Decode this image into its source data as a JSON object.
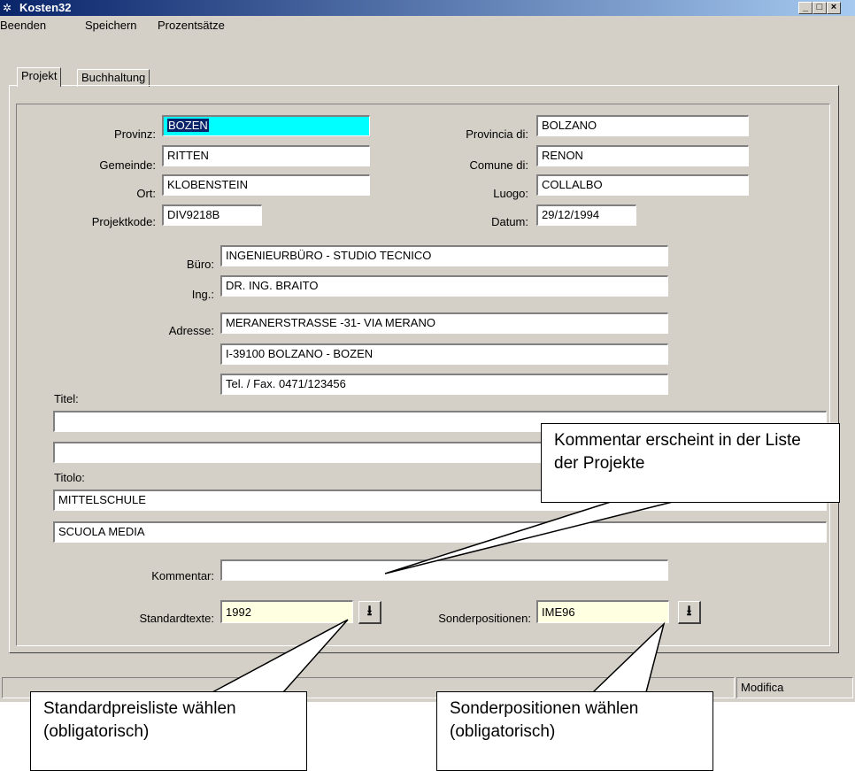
{
  "window": {
    "title": "Kosten32",
    "icon": "app-icon"
  },
  "menu": [
    "Beenden",
    "Speichern",
    "Prozentsätze"
  ],
  "tabs": [
    "Projekt",
    "Buchhaltung"
  ],
  "form": {
    "provinz_label": "Provinz:",
    "provinz_value": "BOZEN",
    "gemeinde_label": "Gemeinde:",
    "gemeinde_value": "RITTEN",
    "ort_label": "Ort:",
    "ort_value": "KLOBENSTEIN",
    "projektkode_label": "Projektkode:",
    "projektkode_value": "DIV9218B",
    "provincia_label": "Provincia di:",
    "provincia_value": "BOLZANO",
    "comune_label": "Comune di:",
    "comune_value": "RENON",
    "luogo_label": "Luogo:",
    "luogo_value": "COLLALBO",
    "datum_label": "Datum:",
    "datum_value": "29/12/1994",
    "buero_label": "Büro:",
    "buero_value": "INGENIEURBÜRO - STUDIO TECNICO",
    "ing_label": "Ing.:",
    "ing_value": "DR. ING. BRAITO",
    "adresse_label": "Adresse:",
    "adresse_1": "MERANERSTRASSE -31- VIA MERANO",
    "adresse_2": "I-39100 BOLZANO - BOZEN",
    "adresse_3": "Tel. / Fax. 0471/123456",
    "titel_label": "Titel:",
    "titel_1": "",
    "titel_2": "",
    "titolo_label": "Titolo:",
    "titolo_1": "MITTELSCHULE",
    "titolo_2": "SCUOLA MEDIA",
    "kommentar_label": "Kommentar:",
    "kommentar_value": "",
    "standardtexte_label": "Standardtexte:",
    "standardtexte_value": "1992",
    "sonderpositionen_label": "Sonderpositionen:",
    "sonderpositionen_value": "IME96",
    "dropdown_glyph": "⭳"
  },
  "status": {
    "mode": "Modifica"
  },
  "callouts": {
    "kommentar": "Kommentar erscheint in der Liste der Projekte",
    "standard": "Standardpreisliste wählen (obligatorisch)",
    "sonder": "Sonderpositionen wählen (obligatorisch)"
  },
  "colors": {
    "titlebar": "#0a246a",
    "highlight_field": "#00ffff",
    "lookup_field": "#ffffe1",
    "window_bg": "#d4d0c8"
  }
}
